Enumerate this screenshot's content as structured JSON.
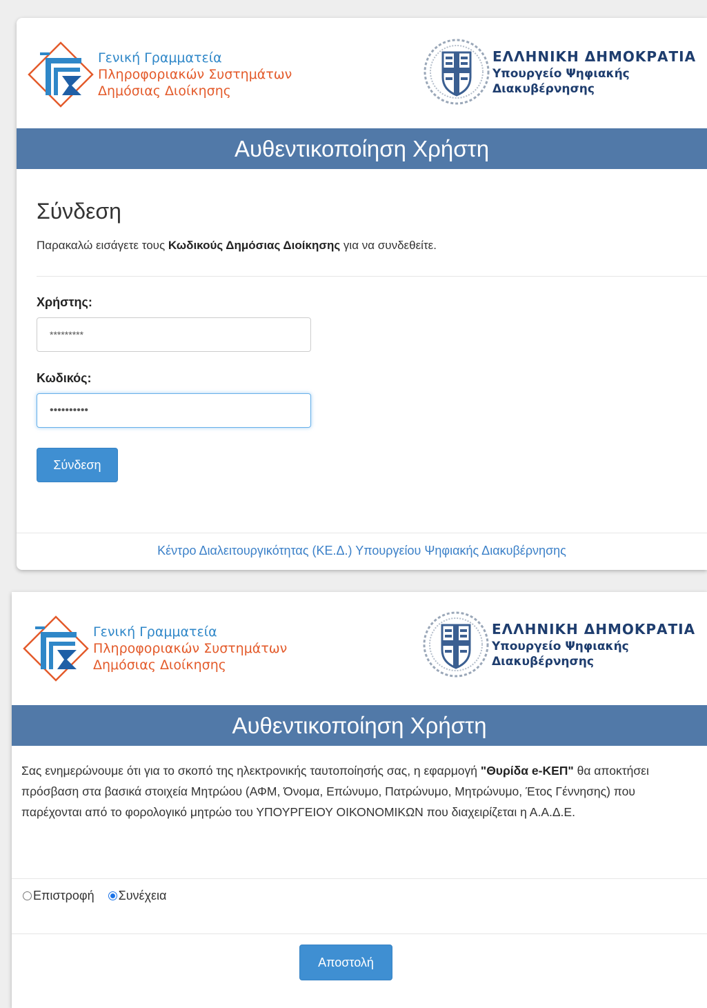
{
  "header": {
    "org_line1": "Γενική Γραμματεία",
    "org_line2": "Πληροφοριακών Συστημάτων",
    "org_line3": "Δημόσιας Διοίκησης",
    "gov_line1": "ΕΛΛΗΝΙΚΗ ΔΗΜΟΚΡΑΤΙΑ",
    "gov_line2": "Υπουργείο Ψηφιακής",
    "gov_line3": "Διακυβέρνησης",
    "left_logo_icon": "ggpsdd-logo-icon",
    "right_logo_icon": "greek-emblem-icon"
  },
  "login": {
    "banner": "Αυθεντικοποίηση Χρήστη",
    "title": "Σύνδεση",
    "instr_before": "Παρακαλώ εισάγετε τους ",
    "instr_bold": "Κωδικούς Δημόσιας Διοίκησης",
    "instr_after": " για να συνδεθείτε.",
    "username_label": "Χρήστης:",
    "username_value": "*********",
    "password_label": "Κωδικός:",
    "password_value": "••••••••••",
    "submit_label": "Σύνδεση",
    "footer": "Κέντρο Διαλειτουργικότητας (ΚΕ.Δ.) Υπουργείου Ψηφιακής Διακυβέρνησης"
  },
  "consent": {
    "banner": "Αυθεντικοποίηση Χρήστη",
    "text_before": "Σας ενημερώνουμε ότι για το σκοπό της ηλεκτρονικής ταυτοποίησής σας, η εφαρμογή ",
    "text_bold": "\"Θυρίδα e-ΚΕΠ\"",
    "text_after": " θα αποκτήσει πρόσβαση στα βασικά στοιχεία Μητρώου (ΑΦΜ, Όνομα, Επώνυμο, Πατρώνυμο, Μητρώνυμο, Έτος Γέννησης) που παρέχονται από το φορολογικό μητρώο του ΥΠΟΥΡΓΕΙΟΥ ΟΙΚΟΝΟΜΙΚΩΝ που διαχειρίζεται η Α.Α.Δ.Ε.",
    "option_back": "Επιστροφή",
    "option_continue": "Συνέχεια",
    "selected_option": "Συνέχεια",
    "submit_label": "Αποστολή"
  },
  "colors": {
    "banner": "#5179a8",
    "button": "#3f8fd2",
    "org_blue": "#2f87c8",
    "org_orange": "#e35a2a",
    "gov_navy": "#1e3d6e"
  }
}
